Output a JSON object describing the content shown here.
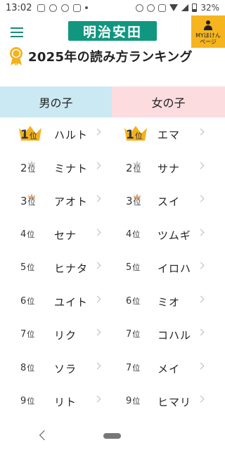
{
  "status_bar": {
    "time": "13:02",
    "battery": "32%"
  },
  "header": {
    "logo": "明治安田",
    "mypage_line1": "MYほけん",
    "mypage_line2": "ページ"
  },
  "title": "2025年の読み方ランキング",
  "tabs": {
    "boys": "男の子",
    "girls": "女の子"
  },
  "rank_suffix": "位",
  "rankings": [
    {
      "boy_rank": "1",
      "boy_name": "ハルト",
      "girl_rank": "1",
      "girl_name": "エマ"
    },
    {
      "boy_rank": "2",
      "boy_name": "ミナト",
      "girl_rank": "2",
      "girl_name": "サナ"
    },
    {
      "boy_rank": "3",
      "boy_name": "アオト",
      "girl_rank": "3",
      "girl_name": "スイ"
    },
    {
      "boy_rank": "4",
      "boy_name": "セナ",
      "girl_rank": "4",
      "girl_name": "ツムギ"
    },
    {
      "boy_rank": "5",
      "boy_name": "ヒナタ",
      "girl_rank": "5",
      "girl_name": "イロハ"
    },
    {
      "boy_rank": "6",
      "boy_name": "ユイト",
      "girl_rank": "6",
      "girl_name": "ミオ"
    },
    {
      "boy_rank": "7",
      "boy_name": "リク",
      "girl_rank": "7",
      "girl_name": "コハル"
    },
    {
      "boy_rank": "8",
      "boy_name": "ソラ",
      "girl_rank": "7",
      "girl_name": "メイ"
    },
    {
      "boy_rank": "9",
      "boy_name": "リト",
      "girl_rank": "9",
      "girl_name": "ヒマリ"
    }
  ],
  "icons": {
    "menu": "hamburger-icon",
    "mypage": "person-icon",
    "award": "award-ribbon-icon",
    "crown_gold": "gold-crown-icon",
    "crown_small": "small-crown-icon",
    "chevron": "chevron-right-icon"
  },
  "colors": {
    "brand_green": "#11977f",
    "mypage_yellow": "#f6b51f",
    "boys_tab": "#cbe9f2",
    "girls_tab": "#fcdcdf",
    "crown_gold": "#f3b21c",
    "crown_silver": "#c8c8c8",
    "crown_bronze": "#d7a27a"
  }
}
